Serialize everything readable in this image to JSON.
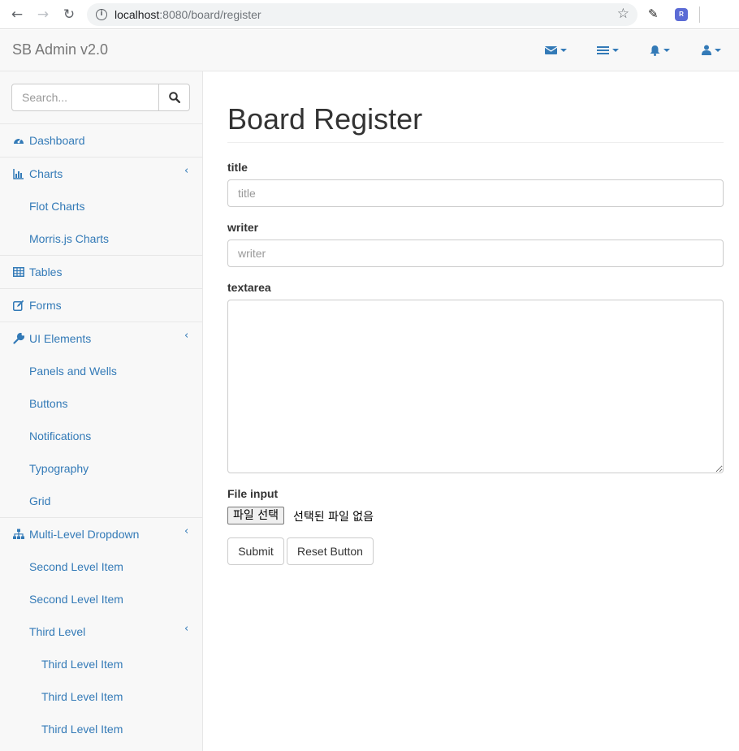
{
  "browser": {
    "url_host": "localhost",
    "url_rest": ":8080/board/register",
    "ext_label": "R"
  },
  "navbar": {
    "brand": "SB Admin v2.0"
  },
  "sidebar": {
    "search_placeholder": "Search...",
    "items": [
      {
        "label": "Dashboard",
        "icon": "dashboard-icon"
      },
      {
        "label": "Charts",
        "icon": "bar-chart-icon"
      },
      {
        "label": "Flot Charts"
      },
      {
        "label": "Morris.js Charts"
      },
      {
        "label": "Tables",
        "icon": "table-icon"
      },
      {
        "label": "Forms",
        "icon": "edit-icon"
      },
      {
        "label": "UI Elements",
        "icon": "wrench-icon"
      },
      {
        "label": "Panels and Wells"
      },
      {
        "label": "Buttons"
      },
      {
        "label": "Notifications"
      },
      {
        "label": "Typography"
      },
      {
        "label": "Grid"
      },
      {
        "label": "Multi-Level Dropdown",
        "icon": "sitemap-icon"
      },
      {
        "label": "Second Level Item"
      },
      {
        "label": "Second Level Item"
      },
      {
        "label": "Third Level"
      },
      {
        "label": "Third Level Item"
      },
      {
        "label": "Third Level Item"
      },
      {
        "label": "Third Level Item"
      }
    ]
  },
  "main": {
    "title": "Board Register",
    "fields": [
      {
        "label": "title",
        "placeholder": "title"
      },
      {
        "label": "writer",
        "placeholder": "writer"
      },
      {
        "label": "textarea",
        "placeholder": ""
      }
    ],
    "file": {
      "label": "File input",
      "button": "파일 선택",
      "status": "선택된 파일 없음"
    },
    "submit_label": "Submit",
    "reset_label": "Reset Button"
  },
  "colors": {
    "link": "#337ab7",
    "navbar_bg": "#f8f8f8"
  }
}
